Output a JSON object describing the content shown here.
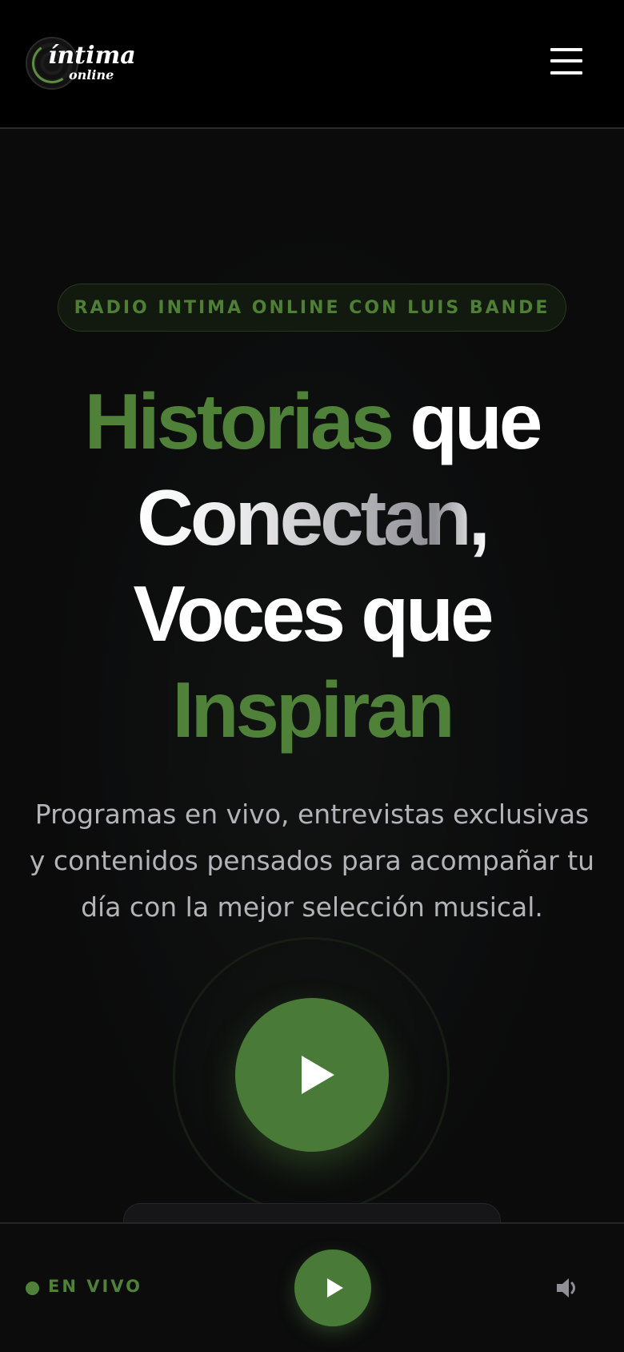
{
  "header": {
    "logo_word": "íntima",
    "logo_sub": "online",
    "menu_icon": "hamburger-menu-icon"
  },
  "hero": {
    "tagline": "RADIO INTIMA ONLINE CON LUIS BANDE",
    "headline": {
      "line1_green": "Historias",
      "line1_white": "que",
      "line2": "Conectan,",
      "line3": "Voces que",
      "line4": "Inspiran"
    },
    "subtitle": "Programas en vivo, entrevistas exclusivas y contenidos pensados para acompañar tu día con la mejor selección musical.",
    "play_icon": "play-icon"
  },
  "player": {
    "live_label": "EN VIVO",
    "play_icon": "play-icon",
    "volume_icon": "volume-icon"
  },
  "colors": {
    "accent_green": "#4f8238",
    "button_green": "#4a7a37",
    "background": "#0b0b0c",
    "header_bg": "#000000",
    "subtitle_gray": "#b3b3b8"
  }
}
